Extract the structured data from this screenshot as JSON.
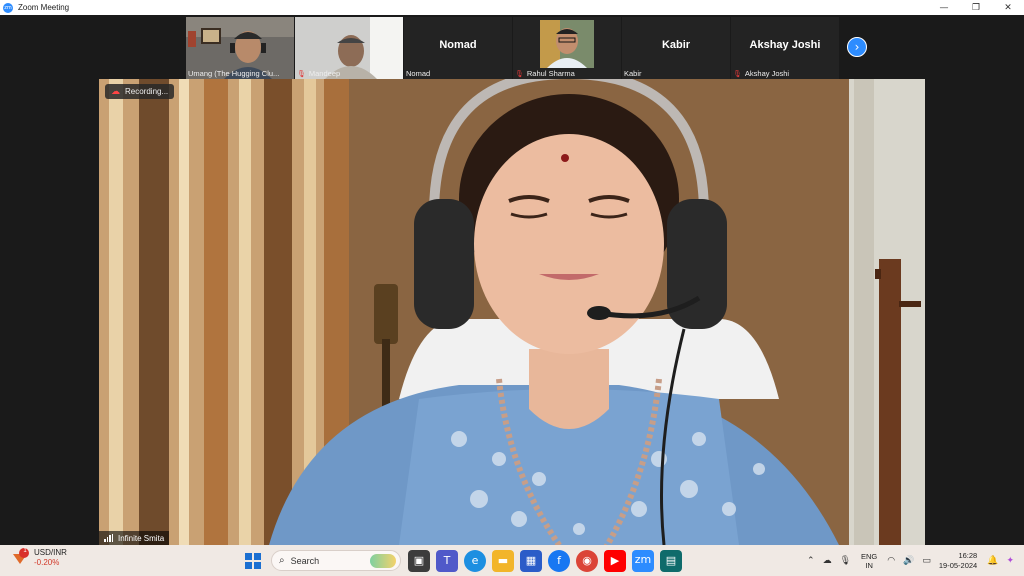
{
  "window": {
    "title": "Zoom Meeting",
    "controls": [
      "—",
      "❐",
      "✕"
    ]
  },
  "recording": {
    "label": "Recording..."
  },
  "participants": [
    {
      "name": "Umang (The Hugging Clu...",
      "muted": false,
      "video": true
    },
    {
      "name": "Mandeep",
      "muted": true,
      "video": true
    },
    {
      "name": "Nomad",
      "muted": false,
      "video": false,
      "display": "Nomad"
    },
    {
      "name": "Rahul Sharma",
      "muted": true,
      "video": true
    },
    {
      "name": "Kabir",
      "muted": false,
      "video": false,
      "display": "Kabir"
    },
    {
      "name": "Akshay Joshi",
      "muted": true,
      "video": false,
      "display": "Akshay Joshi"
    }
  ],
  "speaker": {
    "name": "Infinite Smita"
  },
  "taskbar": {
    "ticker": {
      "symbol": "USD/INR",
      "change": "-0.20%",
      "badge": "1"
    },
    "search_placeholder": "Search",
    "language": {
      "line1": "ENG",
      "line2": "IN"
    },
    "time": "16:28",
    "date": "19-05-2024"
  },
  "colors": {
    "zoom_blue": "#2d8cff",
    "muted_red": "#e03a3a",
    "negative_red": "#d23a2a"
  }
}
